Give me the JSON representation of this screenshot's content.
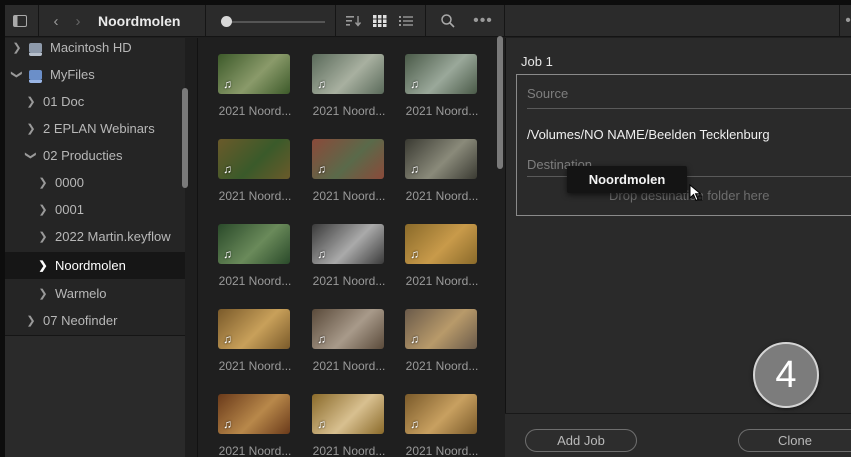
{
  "toolbar": {
    "title": "Noordmolen",
    "icons": [
      "sidebar-toggle-icon",
      "back-icon",
      "forward-icon",
      "sort-icon",
      "grid-view-icon",
      "list-view-icon",
      "search-icon",
      "more-icon",
      "more-icon"
    ],
    "thumbnail_size_level": 0.05
  },
  "sidebar": {
    "items": [
      {
        "label": "Macintosh HD",
        "indent": 0,
        "chevron": ">",
        "icon": "drive-icon",
        "selected": false
      },
      {
        "label": "MyFiles",
        "indent": 0,
        "chevron": "v",
        "icon": "drive-icon",
        "selected": false
      },
      {
        "label": "01 Doc",
        "indent": 1,
        "chevron": ">",
        "selected": false
      },
      {
        "label": "2 EPLAN Webinars",
        "indent": 1,
        "chevron": ">",
        "selected": false
      },
      {
        "label": "02 Producties",
        "indent": 1,
        "chevron": "v",
        "selected": false
      },
      {
        "label": "0000",
        "indent": 2,
        "chevron": ">",
        "selected": false
      },
      {
        "label": "0001",
        "indent": 2,
        "chevron": ">",
        "selected": false
      },
      {
        "label": "2022 Martin.keyflow",
        "indent": 2,
        "chevron": ">",
        "selected": false
      },
      {
        "label": "Noordmolen",
        "indent": 2,
        "chevron": ">",
        "selected": true
      },
      {
        "label": "Warmelo",
        "indent": 2,
        "chevron": ">",
        "selected": false
      },
      {
        "label": "07 Neofinder",
        "indent": 1,
        "chevron": ">",
        "selected": false
      }
    ]
  },
  "grid": {
    "caption": "2021 Noord...",
    "thumbnails": [
      {
        "c1": "#3d5a2a",
        "c2": "#8a9a6a"
      },
      {
        "c1": "#5a6a5a",
        "c2": "#a8b0a0"
      },
      {
        "c1": "#4a5a48",
        "c2": "#9aa89a"
      },
      {
        "c1": "#6a5a2a",
        "c2": "#3a5a2a"
      },
      {
        "c1": "#8a4a3a",
        "c2": "#5a6a4a"
      },
      {
        "c1": "#3a3a32",
        "c2": "#8a8a7a"
      },
      {
        "c1": "#2a4a2a",
        "c2": "#6a8a5a"
      },
      {
        "c1": "#3a3a3a",
        "c2": "#aaaaaa"
      },
      {
        "c1": "#8a6a2a",
        "c2": "#c89a4a"
      },
      {
        "c1": "#7a5a2a",
        "c2": "#c8a05a"
      },
      {
        "c1": "#5a4a3a",
        "c2": "#a89a8a"
      },
      {
        "c1": "#6a5a4a",
        "c2": "#b89a6a"
      },
      {
        "c1": "#6a3a1a",
        "c2": "#b8884a"
      },
      {
        "c1": "#8a6a2a",
        "c2": "#d8c090"
      },
      {
        "c1": "#7a5a2a",
        "c2": "#c8a060"
      }
    ]
  },
  "panel": {
    "job_title": "Job 1",
    "source_label": "Source",
    "source_value": "/Volumes/NO NAME/Beelden Tecklenburg",
    "destination_label": "Destination",
    "destination_placeholder": "Drop destination folder here",
    "tooltip": "Noordmolen",
    "step_number": "4",
    "add_job_label": "Add Job",
    "clone_label": "Clone"
  }
}
